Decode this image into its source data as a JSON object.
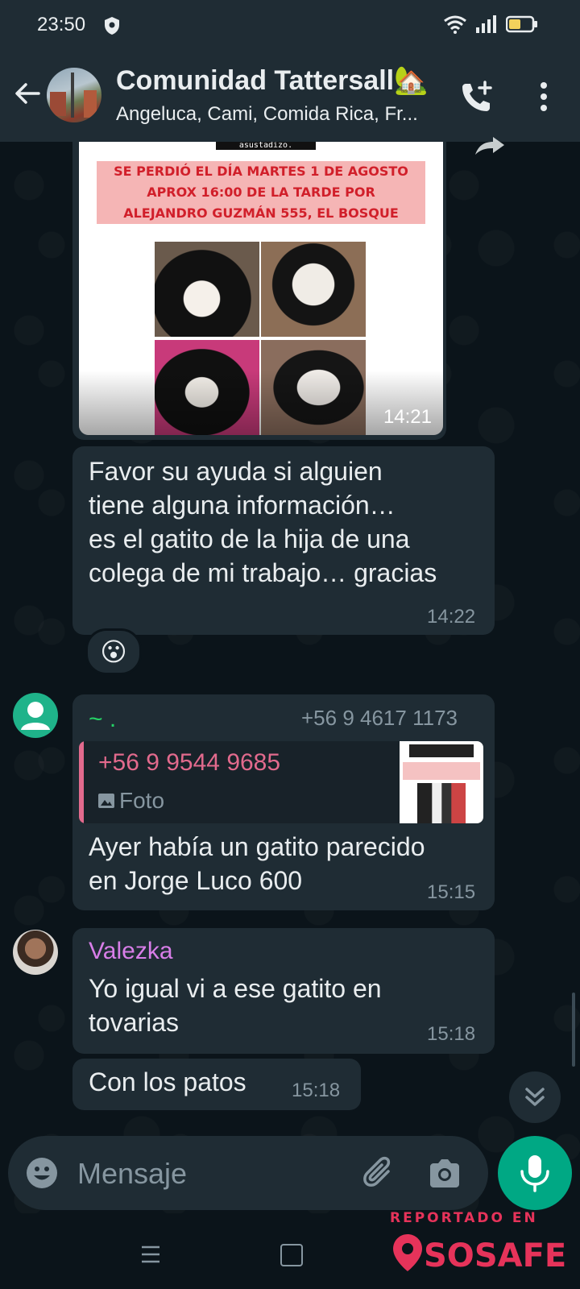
{
  "status_bar": {
    "time": "23:50"
  },
  "header": {
    "title": "Comunidad Tattersall🏡",
    "subtitle": "Angeluca, Cami, Comida Rica, Fr..."
  },
  "flyer": {
    "top_text": "asustadizo.",
    "lines": [
      "SE PERDIÓ EL DÍA MARTES 1 DE AGOSTO",
      "APROX 16:00 DE LA TARDE POR",
      "ALEJANDRO GUZMÁN 555, EL BOSQUE"
    ],
    "time": "14:21"
  },
  "messages": [
    {
      "lines": [
        "Favor su ayuda si alguien",
        "tiene alguna información…",
        "es el gatito de la hija de una",
        "colega de mi trabajo… gracias"
      ],
      "time": "14:22",
      "reaction": "😮"
    },
    {
      "sender": "~ .",
      "sender_phone": "+56 9 4617 1173",
      "quote": {
        "phone": "+56 9 9544 9685",
        "type": "Foto"
      },
      "lines": [
        "Ayer había un gatito parecido",
        "en Jorge Luco 600"
      ],
      "time": "15:15"
    },
    {
      "sender": "Valezka",
      "lines": [
        "Yo igual vi a ese gatito en",
        "tovarias"
      ],
      "time": "15:18"
    },
    {
      "lines": [
        "Con los patos"
      ],
      "time": "15:18"
    }
  ],
  "input": {
    "placeholder": "Mensaje"
  },
  "watermark": {
    "label": "REPORTADO EN",
    "brand": "SOSAFE"
  },
  "colors": {
    "background": "#0b141a",
    "bubble": "#1f2c34",
    "accent": "#00a884",
    "sender_tilde": "#25d366",
    "sender_valezka": "#d87ee8",
    "quote_accent": "#e26a8d",
    "watermark": "#e6335a"
  },
  "icons": [
    "shield-icon",
    "wifi-icon",
    "signal-icon",
    "battery-icon",
    "back-arrow-icon",
    "add-call-icon",
    "more-vert-icon",
    "share-icon",
    "photo-icon",
    "chevron-double-down-icon",
    "emoji-icon",
    "attach-icon",
    "camera-icon",
    "mic-icon",
    "nav-menu-icon",
    "nav-home-icon"
  ]
}
